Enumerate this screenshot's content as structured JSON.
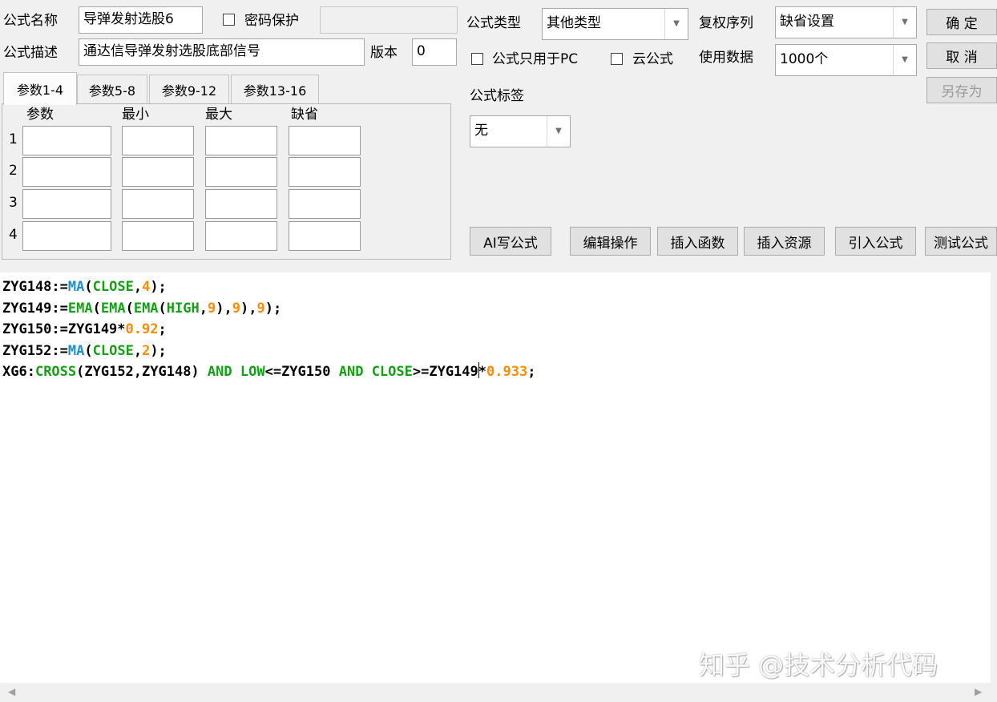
{
  "header": {
    "name_label": "公式名称",
    "name_value": "导弹发射选股6",
    "password_label": "密码保护",
    "desc_label": "公式描述",
    "desc_value": "通达信导弹发射选股底部信号",
    "version_label": "版本",
    "version_value": "0"
  },
  "right_panel": {
    "type_label": "公式类型",
    "type_value": "其他类型",
    "rights_label": "复权序列",
    "rights_value": "缺省设置",
    "pc_only_label": "公式只用于PC",
    "cloud_label": "云公式",
    "data_label": "使用数据",
    "data_value": "1000个",
    "tag_label": "公式标签",
    "tag_value": "无"
  },
  "buttons": {
    "ok": "确  定",
    "cancel": "取  消",
    "save_as": "另存为",
    "ai_write": "AI写公式",
    "edit_ops": "编辑操作",
    "insert_func": "插入函数",
    "insert_res": "插入资源",
    "import_formula": "引入公式",
    "test_formula": "测试公式"
  },
  "tabs": [
    "参数1-4",
    "参数5-8",
    "参数9-12",
    "参数13-16"
  ],
  "param_headers": [
    "参数",
    "最小",
    "最大",
    "缺省"
  ],
  "param_rows": [
    "1",
    "2",
    "3",
    "4"
  ],
  "code": {
    "line1": {
      "a": "ZYG148:=",
      "b": "MA",
      "c": "(",
      "d": "CLOSE",
      "e": ",",
      "f": "4",
      "g": ");"
    },
    "line2": {
      "a": "ZYG149:=",
      "b": "EMA",
      "c": "(",
      "d": "EMA",
      "e": "(",
      "f": "EMA",
      "g": "(",
      "h": "HIGH",
      "i": ",",
      "j": "9",
      "k": "),",
      "l": "9",
      "m": "),",
      "n": "9",
      "o": ");"
    },
    "line3": {
      "a": "ZYG150:=ZYG149*",
      "b": "0.92",
      "c": ";"
    },
    "line4": {
      "a": "ZYG152:=",
      "b": "MA",
      "c": "(",
      "d": "CLOSE",
      "e": ",",
      "f": "2",
      "g": ");"
    },
    "line5": {
      "a": "XG6:",
      "b": "CROSS",
      "c": "(ZYG152,ZYG148) ",
      "d": "AND",
      "e": " ",
      "f": "LOW",
      "g": "<=ZYG150 ",
      "h": "AND",
      "i": " ",
      "j": "CLOSE",
      "k": ">=ZYG149",
      "l": "*",
      "m": "0.933",
      "n": ";"
    }
  },
  "watermark": "知乎 @技术分析代码"
}
